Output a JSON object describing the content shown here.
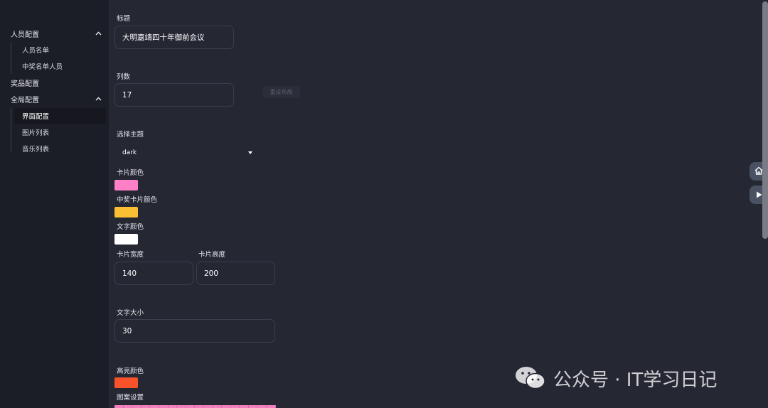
{
  "sidebar": {
    "groups": [
      {
        "label": "人员配置",
        "items": [
          "人员名单",
          "中奖名单人员"
        ]
      },
      {
        "label": "奖品配置"
      },
      {
        "label": "全局配置",
        "items": [
          "界面配置",
          "图片列表",
          "音乐列表"
        ],
        "active_item": "界面配置"
      }
    ]
  },
  "form": {
    "title_label": "标题",
    "title_value": "大明嘉靖四十年御前会议",
    "columns_label": "列数",
    "columns_value": "17",
    "reset_layout_label": "重设布局",
    "theme_label": "选择主题",
    "theme_value": "dark",
    "card_color_label": "卡片颜色",
    "card_color": "#ff80c6",
    "winner_card_color_label": "中奖卡片颜色",
    "winner_card_color": "#fbbf33",
    "text_color_label": "文字颜色",
    "text_color": "#ffffff",
    "card_width_label": "卡片宽度",
    "card_width_value": "140",
    "card_height_label": "卡片高度",
    "card_height_value": "200",
    "font_size_label": "文字大小",
    "font_size_value": "30",
    "highlight_color_label": "高亮颜色",
    "highlight_color": "#f8522a",
    "pattern_label": "图案设置",
    "pattern_color": "#f47fbf"
  },
  "float_buttons": {
    "home_icon": "home-icon",
    "play_icon": "play-icon"
  },
  "watermark": {
    "text": "公众号 · IT学习日记"
  }
}
